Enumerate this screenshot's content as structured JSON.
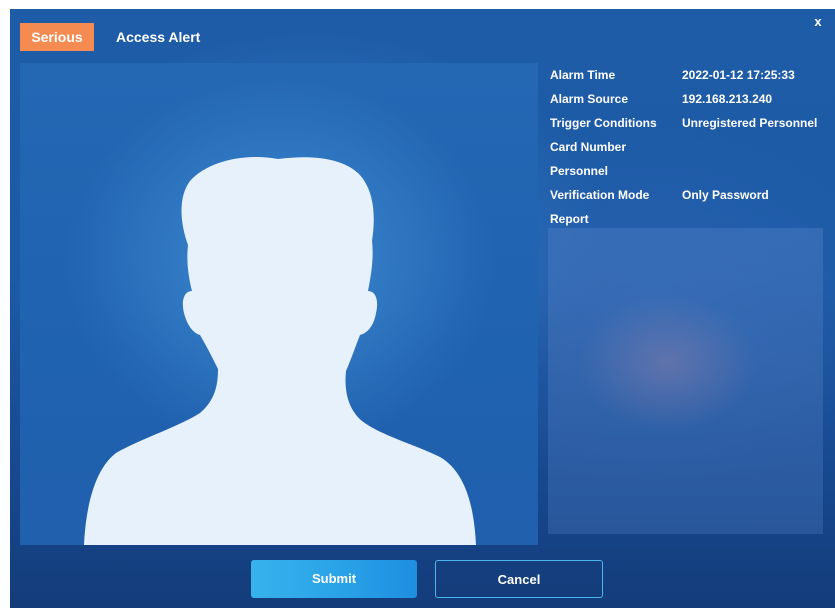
{
  "dialog": {
    "severity": "Serious",
    "title": "Access Alert",
    "close_label": "x"
  },
  "info": [
    {
      "label": "Alarm Time",
      "value": "2022-01-12 17:25:33"
    },
    {
      "label": "Alarm Source",
      "value": "192.168.213.240"
    },
    {
      "label": "Trigger Conditions",
      "value": "Unregistered Personnel"
    },
    {
      "label": "Card Number",
      "value": ""
    },
    {
      "label": "Personnel",
      "value": ""
    },
    {
      "label": "Verification Mode",
      "value": "Only Password"
    },
    {
      "label": "Report",
      "value": ""
    }
  ],
  "buttons": {
    "submit": "Submit",
    "cancel": "Cancel"
  },
  "colors": {
    "severity_badge": "#f68b52",
    "dialog_bg": "#1c5aa6",
    "silhouette": "#e6f1fc",
    "submit_bg": "#2aa4e8",
    "cancel_border": "#4ab5ef"
  },
  "icons": {
    "photo_placeholder": "person-silhouette-icon"
  }
}
